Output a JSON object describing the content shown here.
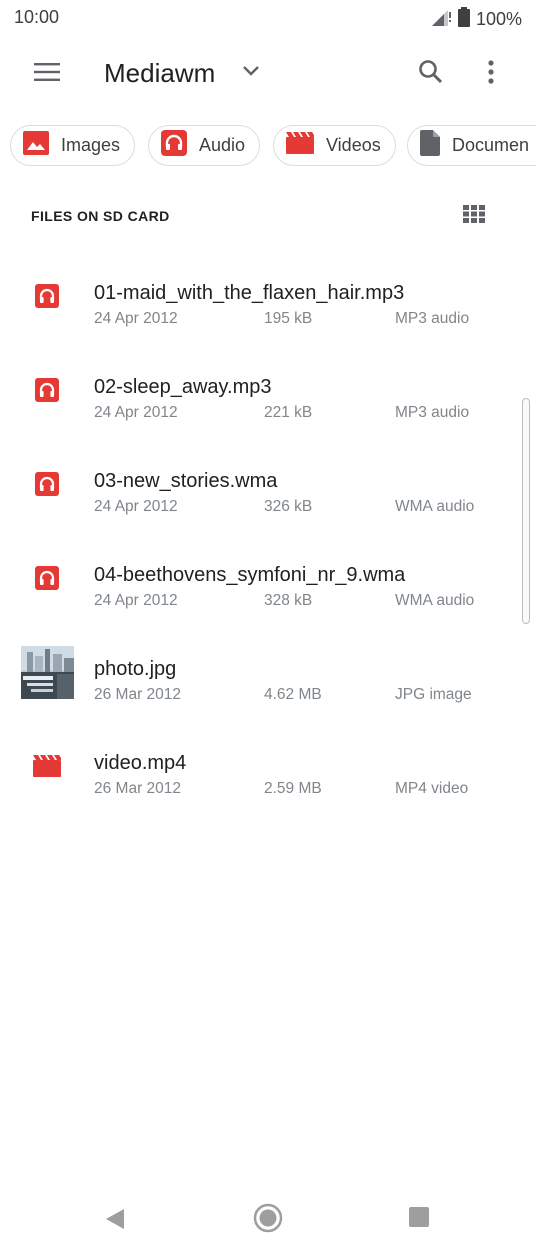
{
  "status_bar": {
    "time": "10:00",
    "battery_text": "100%",
    "icons": [
      "signal-icon",
      "battery-icon"
    ]
  },
  "app_bar": {
    "title": "Mediawm",
    "icons": [
      "menu-icon",
      "chevron-down-icon",
      "search-icon",
      "more-vert-icon"
    ]
  },
  "chips": [
    {
      "label": "Images",
      "icon": "image-icon"
    },
    {
      "label": "Audio",
      "icon": "headphones-icon"
    },
    {
      "label": "Videos",
      "icon": "video-icon"
    },
    {
      "label": "Documen",
      "icon": "document-icon"
    }
  ],
  "section": {
    "title": "FILES ON SD CARD",
    "view_icon": "grid-view-icon"
  },
  "files": [
    {
      "name": "01-maid_with_the_flaxen_hair.mp3",
      "date": "24 Apr 2012",
      "size": "195 kB",
      "type": "MP3 audio",
      "icon": "audio-file-icon"
    },
    {
      "name": "02-sleep_away.mp3",
      "date": "24 Apr 2012",
      "size": "221 kB",
      "type": "MP3 audio",
      "icon": "audio-file-icon"
    },
    {
      "name": "03-new_stories.wma",
      "date": "24 Apr 2012",
      "size": "326 kB",
      "type": "WMA audio",
      "icon": "audio-file-icon"
    },
    {
      "name": "04-beethovens_symfoni_nr_9.wma",
      "date": "24 Apr 2012",
      "size": "328 kB",
      "type": "WMA audio",
      "icon": "audio-file-icon"
    },
    {
      "name": "photo.jpg",
      "date": "26 Mar 2012",
      "size": "4.62 MB",
      "type": "JPG image",
      "icon": "photo-thumbnail"
    },
    {
      "name": "video.mp4",
      "date": "26 Mar 2012",
      "size": "2.59 MB",
      "type": "MP4 video",
      "icon": "video-file-icon"
    }
  ],
  "nav_bar": {
    "icons": [
      "back-icon",
      "home-icon",
      "recents-icon"
    ]
  },
  "colors": {
    "accent_red": "#e53935",
    "text_primary": "#202124",
    "text_secondary": "#80868b",
    "chip_border": "#dadce0"
  }
}
